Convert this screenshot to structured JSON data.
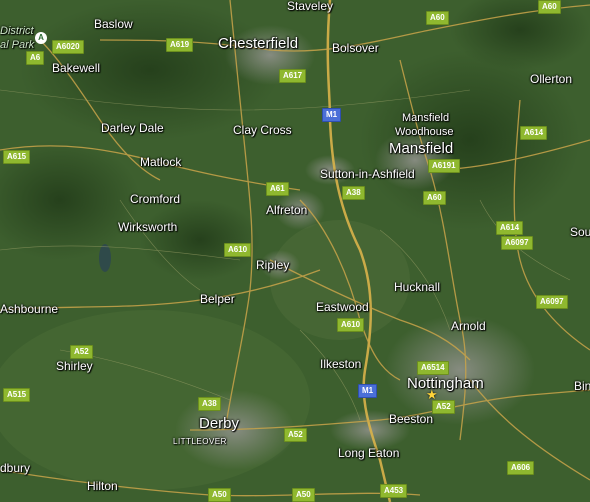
{
  "map": {
    "places": [
      {
        "name": "Staveley",
        "size": "town"
      },
      {
        "name": "Baslow",
        "size": "town"
      },
      {
        "name": "District",
        "size": "park"
      },
      {
        "name": "al Park",
        "size": "park"
      },
      {
        "name": "Chesterfield",
        "size": "city"
      },
      {
        "name": "Bolsover",
        "size": "town"
      },
      {
        "name": "Bakewell",
        "size": "town"
      },
      {
        "name": "Ollerton",
        "size": "town"
      },
      {
        "name": "Darley Dale",
        "size": "town"
      },
      {
        "name": "Clay Cross",
        "size": "town"
      },
      {
        "name": "Mansfield",
        "size": "small"
      },
      {
        "name": "Woodhouse",
        "size": "small"
      },
      {
        "name": "Mansfield",
        "size": "city"
      },
      {
        "name": "Matlock",
        "size": "town"
      },
      {
        "name": "Sutton-in-Ashfield",
        "size": "town"
      },
      {
        "name": "Cromford",
        "size": "town"
      },
      {
        "name": "Alfreton",
        "size": "town"
      },
      {
        "name": "Wirksworth",
        "size": "town"
      },
      {
        "name": "Sou",
        "size": "town"
      },
      {
        "name": "Ripley",
        "size": "town"
      },
      {
        "name": "Hucknall",
        "size": "town"
      },
      {
        "name": "Belper",
        "size": "town"
      },
      {
        "name": "Ashbourne",
        "size": "town"
      },
      {
        "name": "Eastwood",
        "size": "town"
      },
      {
        "name": "Arnold",
        "size": "town"
      },
      {
        "name": "Shirley",
        "size": "town"
      },
      {
        "name": "Ilkeston",
        "size": "town"
      },
      {
        "name": "Nottingham",
        "size": "city"
      },
      {
        "name": "Bin",
        "size": "town"
      },
      {
        "name": "Beeston",
        "size": "town"
      },
      {
        "name": "Derby",
        "size": "city"
      },
      {
        "name": "LITTLEOVER",
        "size": "tiny"
      },
      {
        "name": "Long Eaton",
        "size": "town"
      },
      {
        "name": "dbury",
        "size": "town"
      },
      {
        "name": "Hilton",
        "size": "town"
      }
    ],
    "roads": [
      "A60",
      "A619",
      "A6020",
      "A6",
      "A617",
      "M1",
      "A615",
      "A614",
      "A61",
      "A6191",
      "A38",
      "A60",
      "A614",
      "A6097",
      "A610",
      "A6097",
      "A610",
      "A52",
      "A6514",
      "A515",
      "M1",
      "A38",
      "A52",
      "A52",
      "A50",
      "A50",
      "A453",
      "A606",
      "A60"
    ],
    "park_marker": "A",
    "colors": {
      "a_road": "#8fb82f",
      "motorway": "#4a6fd8",
      "land": "#3a5a2c",
      "urban": "#7a8072"
    }
  }
}
